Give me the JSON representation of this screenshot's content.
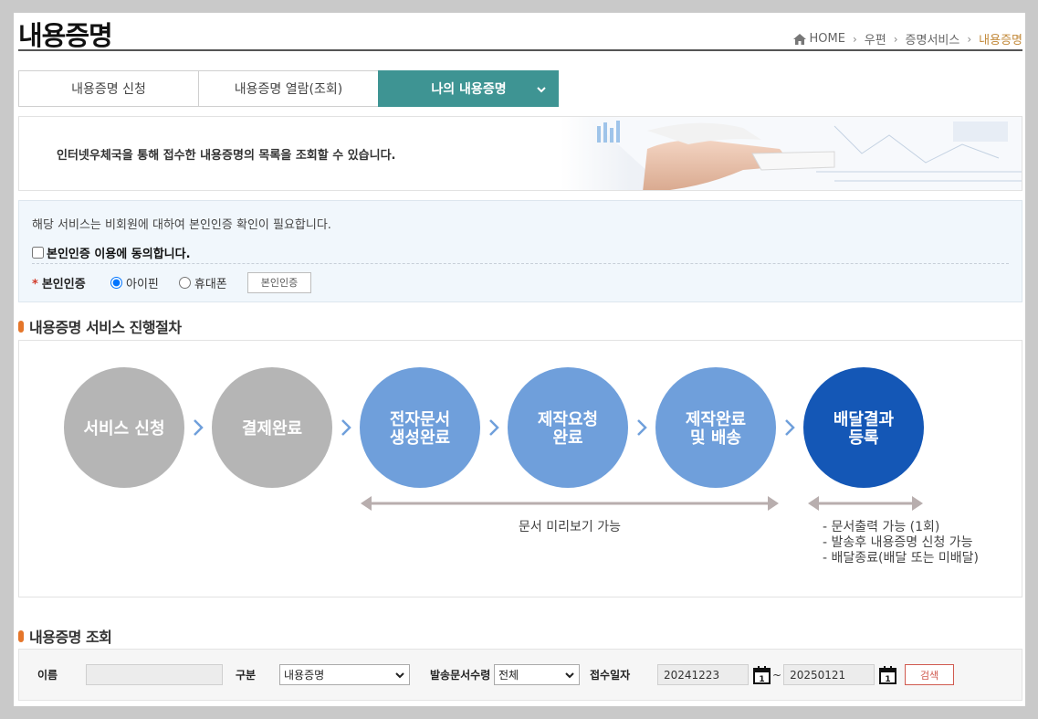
{
  "header": {
    "page_title": "내용증명",
    "breadcrumb": [
      "HOME",
      "우편",
      "증명서비스",
      "내용증명"
    ]
  },
  "tabs": [
    {
      "label": "내용증명 신청",
      "active": false
    },
    {
      "label": "내용증명 열람(조회)",
      "active": false
    },
    {
      "label": "나의 내용증명",
      "active": true
    }
  ],
  "banner": {
    "text": "인터넷우체국을 통해 접수한 내용증명의 목록을 조회할 수 있습니다."
  },
  "auth": {
    "note": "해당 서비스는 비회원에 대하여 본인인증 확인이 필요합니다.",
    "agree_label": "본인인증 이용에 동의합니다.",
    "agree_checked": false,
    "row_label": "본인인증",
    "options": [
      {
        "label": "아이핀",
        "selected": true
      },
      {
        "label": "휴대폰",
        "selected": false
      }
    ],
    "button_label": "본인인증"
  },
  "process": {
    "section_title": "내용증명 서비스 진행절차",
    "steps": [
      {
        "lines": [
          "서비스 신청"
        ],
        "color": "#b5b5b5"
      },
      {
        "lines": [
          "결제완료"
        ],
        "color": "#b5b5b5"
      },
      {
        "lines": [
          "전자문서",
          "생성완료"
        ],
        "color": "#6f9fdb"
      },
      {
        "lines": [
          "제작요청",
          "완료"
        ],
        "color": "#6f9fdb"
      },
      {
        "lines": [
          "제작완료",
          "및 배송"
        ],
        "color": "#6f9fdb"
      },
      {
        "lines": [
          "배달결과",
          "등록"
        ],
        "color": "#1457b6"
      }
    ],
    "preview_caption": "문서 미리보기 가능",
    "result_notes": [
      "- 문서출력 가능 (1회)",
      "- 발송후 내용증명 신청 가능",
      "- 배달종료(배달 또는 미배달)"
    ]
  },
  "search": {
    "section_title": "내용증명 조회",
    "name_label": "이름",
    "name_value": "",
    "type_label": "구분",
    "type_value": "내용증명",
    "count_label": "발송문서수령",
    "count_value": "전체",
    "date_label": "접수일자",
    "date_from": "20241223",
    "date_tilde": "~",
    "date_to": "20250121",
    "search_button": "검색"
  },
  "colors": {
    "tab_active": "#3e9493",
    "accent_orange": "#e5762a",
    "step_gray": "#b5b5b5",
    "step_blue": "#6f9fdb",
    "step_dark_blue": "#1457b6"
  }
}
